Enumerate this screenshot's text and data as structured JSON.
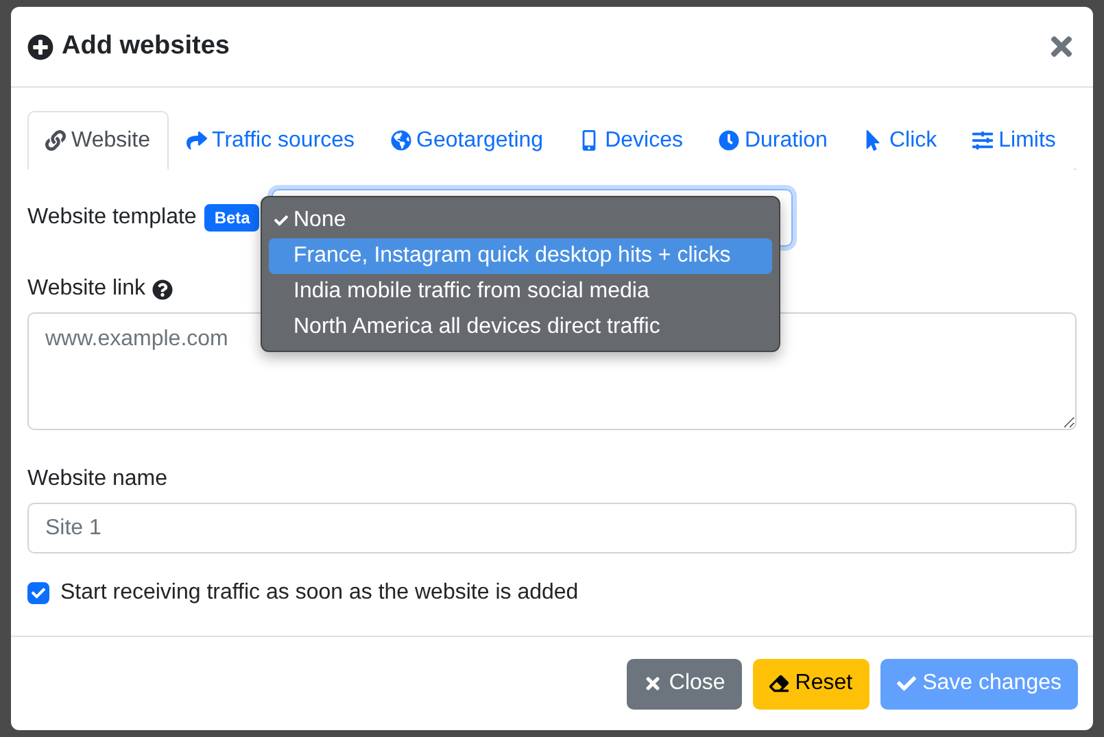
{
  "dialog": {
    "title": "Add websites"
  },
  "tabs": [
    {
      "label": "Website",
      "selected": true
    },
    {
      "label": "Traffic sources",
      "selected": false
    },
    {
      "label": "Geotargeting",
      "selected": false
    },
    {
      "label": "Devices",
      "selected": false
    },
    {
      "label": "Duration",
      "selected": false
    },
    {
      "label": "Click",
      "selected": false
    },
    {
      "label": "Limits",
      "selected": false
    }
  ],
  "template": {
    "label": "Website template",
    "badge": "Beta",
    "options": [
      {
        "label": "None",
        "selected": true,
        "highlighted": false
      },
      {
        "label": "France, Instagram quick desktop hits + clicks",
        "selected": false,
        "highlighted": true
      },
      {
        "label": "India mobile traffic from social media",
        "selected": false,
        "highlighted": false
      },
      {
        "label": "North America all devices direct traffic",
        "selected": false,
        "highlighted": false
      }
    ]
  },
  "link": {
    "label": "Website link",
    "placeholder": "www.example.com"
  },
  "name": {
    "label": "Website name",
    "placeholder": "Site 1"
  },
  "start_checkbox": {
    "label": "Start receiving traffic as soon as the website is added",
    "checked": true
  },
  "buttons": [
    {
      "kind": "close",
      "label": "Close",
      "disabled": false
    },
    {
      "kind": "reset",
      "label": "Reset",
      "disabled": false
    },
    {
      "kind": "save",
      "label": "Save changes",
      "disabled": true
    }
  ]
}
